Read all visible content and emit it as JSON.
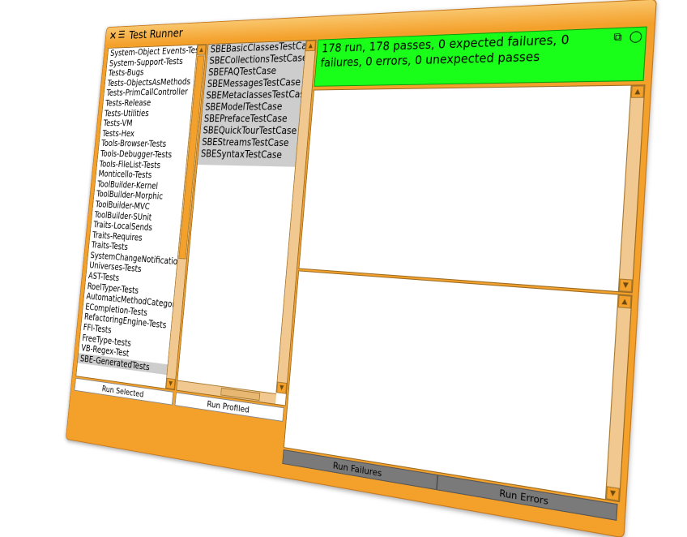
{
  "window": {
    "title": "Test Runner"
  },
  "packages": [
    "System-Object Events-Tests",
    "System-Support-Tests",
    "Tests-Bugs",
    "Tests-ObjectsAsMethods",
    "Tests-PrimCallController",
    "Tests-Release",
    "Tests-Utilities",
    "Tests-VM",
    "Tests-Hex",
    "Tools-Browser-Tests",
    "Tools-Debugger-Tests",
    "Tools-FileList-Tests",
    "Monticello-Tests",
    "ToolBuilder-Kernel",
    "ToolBuilder-Morphic",
    "ToolBuilder-MVC",
    "ToolBuilder-SUnit",
    "Traits-LocalSends",
    "Traits-Requires",
    "Traits-Tests",
    "SystemChangeNotification-Tests",
    "Universes-Tests",
    "AST-Tests",
    "RoelTyper-Tests",
    "AutomaticMethodCategorizer-Tests",
    "ECompletion-Tests",
    "RefactoringEngine-Tests",
    "FFI-Tests",
    "FreeType-tests",
    "VB-Regex-Test",
    "SBE-GeneratedTests"
  ],
  "selected_package": "SBE-GeneratedTests",
  "test_cases": [
    "SBEBasicClassesTestCase",
    "SBECollectionsTestCase",
    "SBEFAQTestCase",
    "SBEMessagesTestCase",
    "SBEMetaclassesTestCase",
    "SBEModelTestCase",
    "SBEPrefaceTestCase",
    "SBEQuickTourTestCase",
    "SBEStreamsTestCase",
    "SBESyntaxTestCase"
  ],
  "status": {
    "text": "178 run, 178 passes, 0 expected failures, 0 failures, 0 errors, 0 unexpected passes",
    "color": "#1aff1a"
  },
  "buttons": {
    "run_selected": "Run Selected",
    "run_profiled": "Run Profiled",
    "run_failures": "Run Failures",
    "run_errors": "Run Errors"
  },
  "icons": {
    "close": "close-icon",
    "menu": "window-menu-icon",
    "collapse": "collapse-icon",
    "expand": "expand-icon"
  }
}
